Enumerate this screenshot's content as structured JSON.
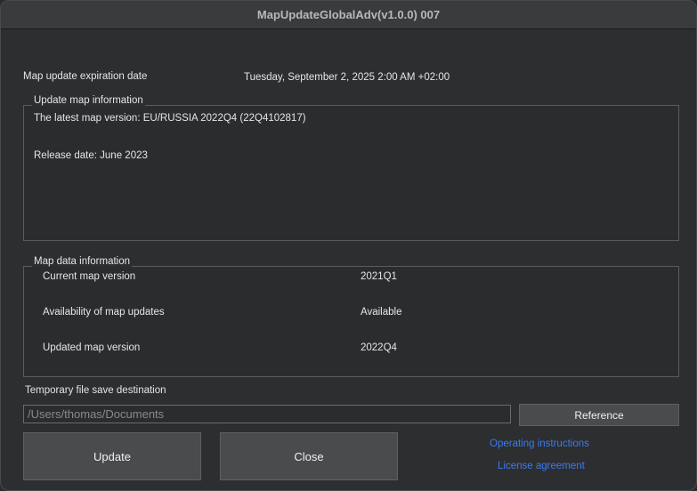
{
  "window": {
    "title": "MapUpdateGlobalAdv(v1.0.0) 007"
  },
  "expiration": {
    "label": "Map update expiration date",
    "value": "Tuesday, September 2, 2025 2:00 AM  +02:00"
  },
  "update_info": {
    "title": "Update map information",
    "latest_version": "The latest map version: EU/RUSSIA 2022Q4 (22Q4102817)",
    "release_date": "Release date: June 2023"
  },
  "map_data": {
    "title": "Map data information",
    "rows": [
      {
        "label": "Current map version",
        "value": "2021Q1"
      },
      {
        "label": "Availability of map updates",
        "value": "Available"
      },
      {
        "label": "Updated map version",
        "value": "2022Q4"
      }
    ]
  },
  "save_destination": {
    "label": "Temporary file save destination",
    "path": "/Users/thomas/Documents",
    "reference_label": "Reference"
  },
  "actions": {
    "update_label": "Update",
    "close_label": "Close"
  },
  "links": {
    "operating_instructions": "Operating instructions",
    "license_agreement": "License agreement"
  }
}
